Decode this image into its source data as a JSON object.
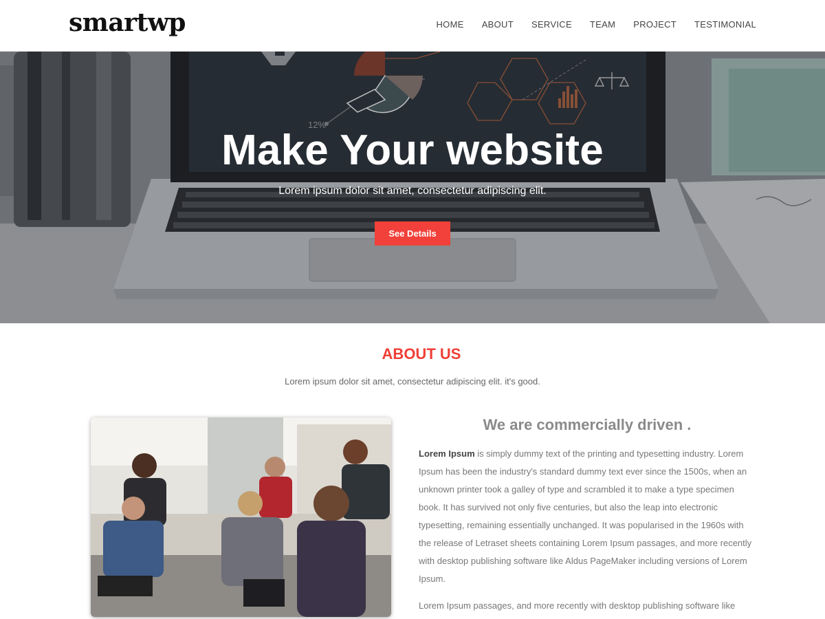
{
  "site": {
    "logo": "smartwp"
  },
  "nav": {
    "items": [
      {
        "label": "HOME",
        "name": "nav-home"
      },
      {
        "label": "ABOUT",
        "name": "nav-about"
      },
      {
        "label": "SERVICE",
        "name": "nav-service"
      },
      {
        "label": "TEAM",
        "name": "nav-team"
      },
      {
        "label": "PROJECT",
        "name": "nav-project"
      },
      {
        "label": "TESTIMONIAL",
        "name": "nav-testimonial"
      }
    ]
  },
  "hero": {
    "title": "Make Your website",
    "subtitle": "Lorem ipsum dolor sit amet, consectetur adipiscing elit.",
    "button_label": "See Details",
    "screen_percent_label": "12%"
  },
  "about": {
    "title": "ABOUT US",
    "subtitle": "Lorem ipsum dolor sit amet, consectetur adipiscing elit. it's good.",
    "heading": "We are commercially driven .",
    "para1_strong": "Lorem Ipsum",
    "para1_rest": " is simply dummy text of the printing and typesetting industry. Lorem Ipsum has been the industry's standard dummy text ever since the 1500s, when an unknown printer took a galley of type and scrambled it to make a type specimen book. It has survived not only five centuries, but also the leap into electronic typesetting, remaining essentially unchanged. It was popularised in the 1960s with the release of Letraset sheets containing Lorem Ipsum passages, and more recently with desktop publishing software like Aldus PageMaker including versions of Lorem Ipsum.",
    "para2": "Lorem Ipsum passages, and more recently with desktop publishing software like Aldus PageMaker including versions of Lorem Ipsum."
  },
  "colors": {
    "accent": "#f2403a",
    "heading_red": "#ef3f36",
    "logo": "#111111"
  }
}
